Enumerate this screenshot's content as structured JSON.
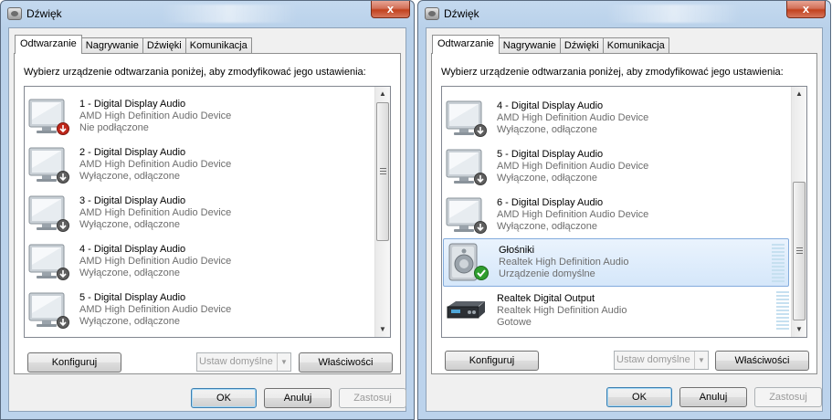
{
  "left_window": {
    "title": "Dźwięk",
    "close_label": "x",
    "tabs": [
      {
        "label": "Odtwarzanie"
      },
      {
        "label": "Nagrywanie"
      },
      {
        "label": "Dźwięki"
      },
      {
        "label": "Komunikacja"
      }
    ],
    "instruction": "Wybierz urządzenie odtwarzania poniżej, aby zmodyfikować jego ustawienia:",
    "devices": [
      {
        "name": "1 - Digital Display Audio",
        "description": "AMD High Definition Audio Device",
        "status": "Nie podłączone",
        "icon": "monitor-icon",
        "badge": "red-down-arrow"
      },
      {
        "name": "2 - Digital Display Audio",
        "description": "AMD High Definition Audio Device",
        "status": "Wyłączone, odłączone",
        "icon": "monitor-icon",
        "badge": "gray-down-arrow"
      },
      {
        "name": "3 - Digital Display Audio",
        "description": "AMD High Definition Audio Device",
        "status": "Wyłączone, odłączone",
        "icon": "monitor-icon",
        "badge": "gray-down-arrow"
      },
      {
        "name": "4 - Digital Display Audio",
        "description": "AMD High Definition Audio Device",
        "status": "Wyłączone, odłączone",
        "icon": "monitor-icon",
        "badge": "gray-down-arrow"
      },
      {
        "name": "5 - Digital Display Audio",
        "description": "AMD High Definition Audio Device",
        "status": "Wyłączone, odłączone",
        "icon": "monitor-icon",
        "badge": "gray-down-arrow"
      }
    ],
    "buttons": {
      "configure": "Konfiguruj",
      "set_default": "Ustaw domyślne",
      "properties": "Właściwości",
      "ok": "OK",
      "cancel": "Anuluj",
      "apply": "Zastosuj"
    }
  },
  "right_window": {
    "title": "Dźwięk",
    "close_label": "x",
    "tabs": [
      {
        "label": "Odtwarzanie"
      },
      {
        "label": "Nagrywanie"
      },
      {
        "label": "Dźwięki"
      },
      {
        "label": "Komunikacja"
      }
    ],
    "instruction": "Wybierz urządzenie odtwarzania poniżej, aby zmodyfikować jego ustawienia:",
    "devices": [
      {
        "name": "4 - Digital Display Audio",
        "description": "AMD High Definition Audio Device",
        "status": "Wyłączone, odłączone",
        "icon": "monitor-icon",
        "badge": "gray-down-arrow"
      },
      {
        "name": "5 - Digital Display Audio",
        "description": "AMD High Definition Audio Device",
        "status": "Wyłączone, odłączone",
        "icon": "monitor-icon",
        "badge": "gray-down-arrow"
      },
      {
        "name": "6 - Digital Display Audio",
        "description": "AMD High Definition Audio Device",
        "status": "Wyłączone, odłączone",
        "icon": "monitor-icon",
        "badge": "gray-down-arrow"
      },
      {
        "name": "Głośniki",
        "description": "Realtek High Definition Audio",
        "status": "Urządzenie domyślne",
        "icon": "speaker-icon",
        "badge": "green-check"
      },
      {
        "name": "Realtek Digital Output",
        "description": "Realtek High Definition Audio",
        "status": "Gotowe",
        "icon": "digital-output-icon",
        "badge": ""
      }
    ],
    "buttons": {
      "configure": "Konfiguruj",
      "set_default": "Ustaw domyślne",
      "properties": "Właściwości",
      "ok": "OK",
      "cancel": "Anuluj",
      "apply": "Zastosuj"
    }
  },
  "colors": {
    "selection_bg": "#d5e7fa",
    "selection_border": "#84acdd",
    "default_badge": "#2f9e2f",
    "disconnected_badge": "#c0281c",
    "level_meter": "#c6e0f0"
  }
}
